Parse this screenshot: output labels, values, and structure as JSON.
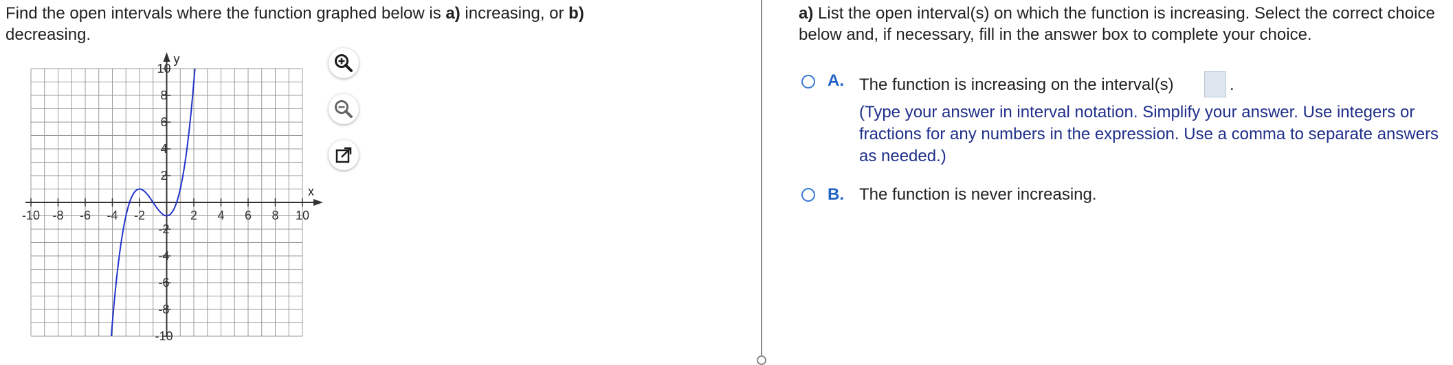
{
  "question": {
    "part1": "Find the open intervals where the function graphed below is ",
    "a_label": "a)",
    "part2": " increasing, or ",
    "b_label": "b)",
    "part3": "decreasing."
  },
  "graph": {
    "x_axis_label": "x",
    "y_axis_label": "y",
    "x_tick_labels": [
      "-10",
      "-8",
      "-6",
      "-4",
      "-2",
      "2",
      "4",
      "6",
      "8",
      "10"
    ],
    "y_tick_labels": [
      "10",
      "8",
      "6",
      "4",
      "2",
      "-2",
      "-4",
      "-6",
      "-8",
      "-10"
    ],
    "x_range": [
      -10,
      10
    ],
    "y_range": [
      -10,
      10
    ],
    "grid": true,
    "curve_color": "#2233cc",
    "local_max": [
      -2,
      1
    ],
    "local_min": [
      0,
      -1
    ]
  },
  "tools": {
    "zoom_in": "zoom-in-icon",
    "zoom_out": "zoom-out-icon",
    "popout": "popout-icon"
  },
  "answer_panel": {
    "prompt_bold": "a)",
    "prompt": " List the open interval(s) on which the function is increasing. Select the correct choice below and, if necessary, fill in the answer box to complete your choice.",
    "choice_a_letter": "A.",
    "choice_a_text": "The function is increasing on the interval(s)",
    "choice_a_suffix": ".",
    "choice_a_hint": "(Type your answer in interval notation. Simplify your answer. Use integers or fractions for any numbers in the expression. Use a comma to separate answers as needed.)",
    "choice_b_letter": "B.",
    "choice_b_text": "The function is never increasing."
  },
  "colors": {
    "accent": "#1f62c4",
    "hint": "#1f2f8a",
    "divider": "#8a8a8a"
  }
}
